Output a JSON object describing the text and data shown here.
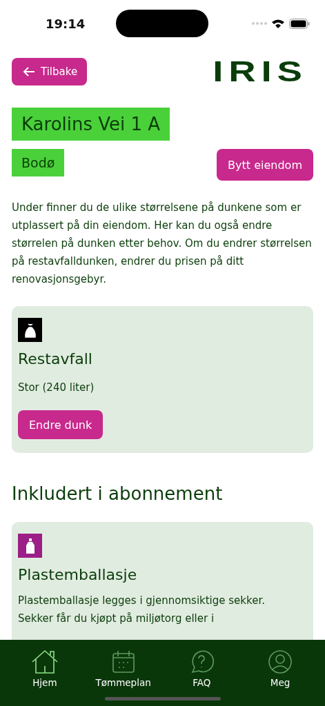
{
  "status_bar": {
    "time": "19:14"
  },
  "header": {
    "back_button": "Tilbake",
    "logo": "IRIS"
  },
  "property": {
    "address": "Karolins Vei 1 A",
    "city": "Bodø",
    "change_button": "Bytt eiendom"
  },
  "intro": "Under finner du de ulike størrelsene på dunkene som er utplassert på din eiendom. Her kan du også endre størrelen på dunken etter behov. Om du endrer størrelsen på restavfalldunken, endrer du prisen på ditt renovasjonsgebyr.",
  "bins": [
    {
      "kind": "bag",
      "color": "#000000",
      "title": "Restavfall",
      "size": "Stor (240 liter)",
      "button": "Endre dunk"
    }
  ],
  "included_heading": "Inkludert i abonnement",
  "included": [
    {
      "kind": "bottle",
      "color": "#9b1f86",
      "title": "Plastemballasje",
      "description": "Plastemballasje legges i gjennomsiktige sekker. Sekker får du kjøpt på miljøtorg eller i"
    }
  ],
  "tabs": [
    {
      "kind": "home",
      "label": "Hjem",
      "selected": true
    },
    {
      "kind": "calendar",
      "label": "Tømmeplan",
      "selected": false
    },
    {
      "kind": "faq",
      "label": "FAQ",
      "selected": false
    },
    {
      "kind": "person",
      "label": "Meg",
      "selected": false
    }
  ]
}
